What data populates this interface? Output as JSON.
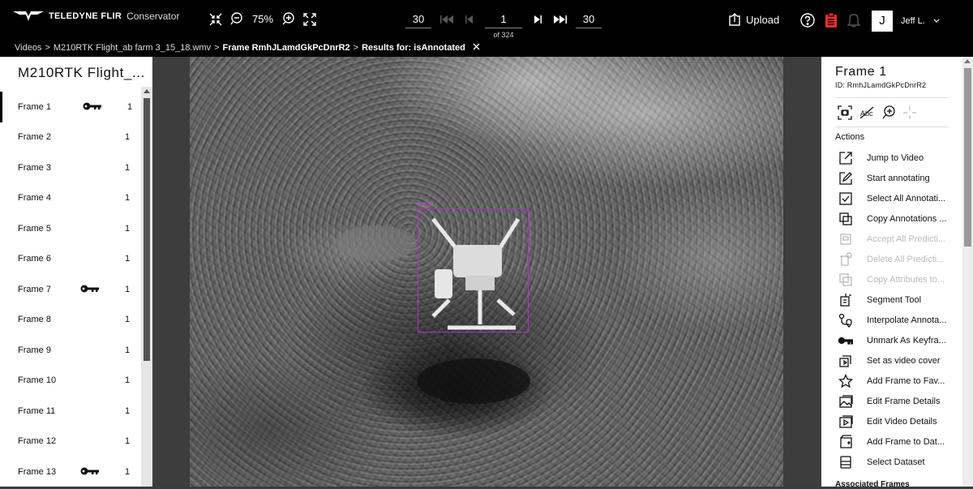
{
  "brand": {
    "company": "TELEDYNE FLIR",
    "product": "Conservator"
  },
  "toolbar": {
    "zoom_level": "75%"
  },
  "pager": {
    "skip_back": "30",
    "current": "1",
    "of_label": "of 324",
    "skip_forward": "30"
  },
  "header": {
    "upload_label": "Upload",
    "user_initial": "J",
    "user_name": "Jeff L."
  },
  "breadcrumb": {
    "videos": "Videos",
    "video": "M210RTK Flight_ab farm 3_15_18.wmv",
    "frame": "Frame RmhJLamdGkPcDnrR2",
    "results": "Results for: isAnnotated"
  },
  "sidebar": {
    "title": "M210RTK Flight_...",
    "frames": [
      {
        "name": "Frame 1",
        "count": "1",
        "keyframe": true
      },
      {
        "name": "Frame 2",
        "count": "1",
        "keyframe": false
      },
      {
        "name": "Frame 3",
        "count": "1",
        "keyframe": false
      },
      {
        "name": "Frame 4",
        "count": "1",
        "keyframe": false
      },
      {
        "name": "Frame 5",
        "count": "1",
        "keyframe": false
      },
      {
        "name": "Frame 6",
        "count": "1",
        "keyframe": false
      },
      {
        "name": "Frame 7",
        "count": "1",
        "keyframe": true
      },
      {
        "name": "Frame 8",
        "count": "1",
        "keyframe": false
      },
      {
        "name": "Frame 9",
        "count": "1",
        "keyframe": false
      },
      {
        "name": "Frame 10",
        "count": "1",
        "keyframe": false
      },
      {
        "name": "Frame 11",
        "count": "1",
        "keyframe": false
      },
      {
        "name": "Frame 12",
        "count": "1",
        "keyframe": false
      },
      {
        "name": "Frame 13",
        "count": "1",
        "keyframe": true
      }
    ]
  },
  "annotation": {
    "color": "#b030d0"
  },
  "panel": {
    "title": "Frame 1",
    "id_label": "ID: RmhJLamdGkPcDnrR2",
    "actions_heading": "Actions",
    "actions": [
      {
        "label": "Jump to Video",
        "icon": "external-link-icon",
        "enabled": true
      },
      {
        "label": "Start annotating",
        "icon": "edit-icon",
        "enabled": true
      },
      {
        "label": "Select All Annotati...",
        "icon": "select-all-icon",
        "enabled": true
      },
      {
        "label": "Copy Annotations ...",
        "icon": "copy-icon",
        "enabled": true
      },
      {
        "label": "Accept All Predicti...",
        "icon": "accept-icon",
        "enabled": false
      },
      {
        "label": "Delete All Predicti...",
        "icon": "delete-icon",
        "enabled": false
      },
      {
        "label": "Copy Attributes to...",
        "icon": "copy-attributes-icon",
        "enabled": false
      },
      {
        "label": "Segment Tool",
        "icon": "segment-icon",
        "enabled": true
      },
      {
        "label": "Interpolate Annota...",
        "icon": "interpolate-icon",
        "enabled": true
      },
      {
        "label": "Unmark As Keyfra...",
        "icon": "key-icon",
        "enabled": true
      },
      {
        "label": "Set as video cover",
        "icon": "cover-icon",
        "enabled": true
      },
      {
        "label": "Add Frame to Fav...",
        "icon": "star-icon",
        "enabled": true
      },
      {
        "label": "Edit Frame Details",
        "icon": "image-edit-icon",
        "enabled": true
      },
      {
        "label": "Edit Video Details",
        "icon": "video-edit-icon",
        "enabled": true
      },
      {
        "label": "Add Frame to Dat...",
        "icon": "add-dataset-icon",
        "enabled": true
      },
      {
        "label": "Select Dataset",
        "icon": "dataset-icon",
        "enabled": true
      }
    ],
    "associated": "Associated Frames"
  }
}
